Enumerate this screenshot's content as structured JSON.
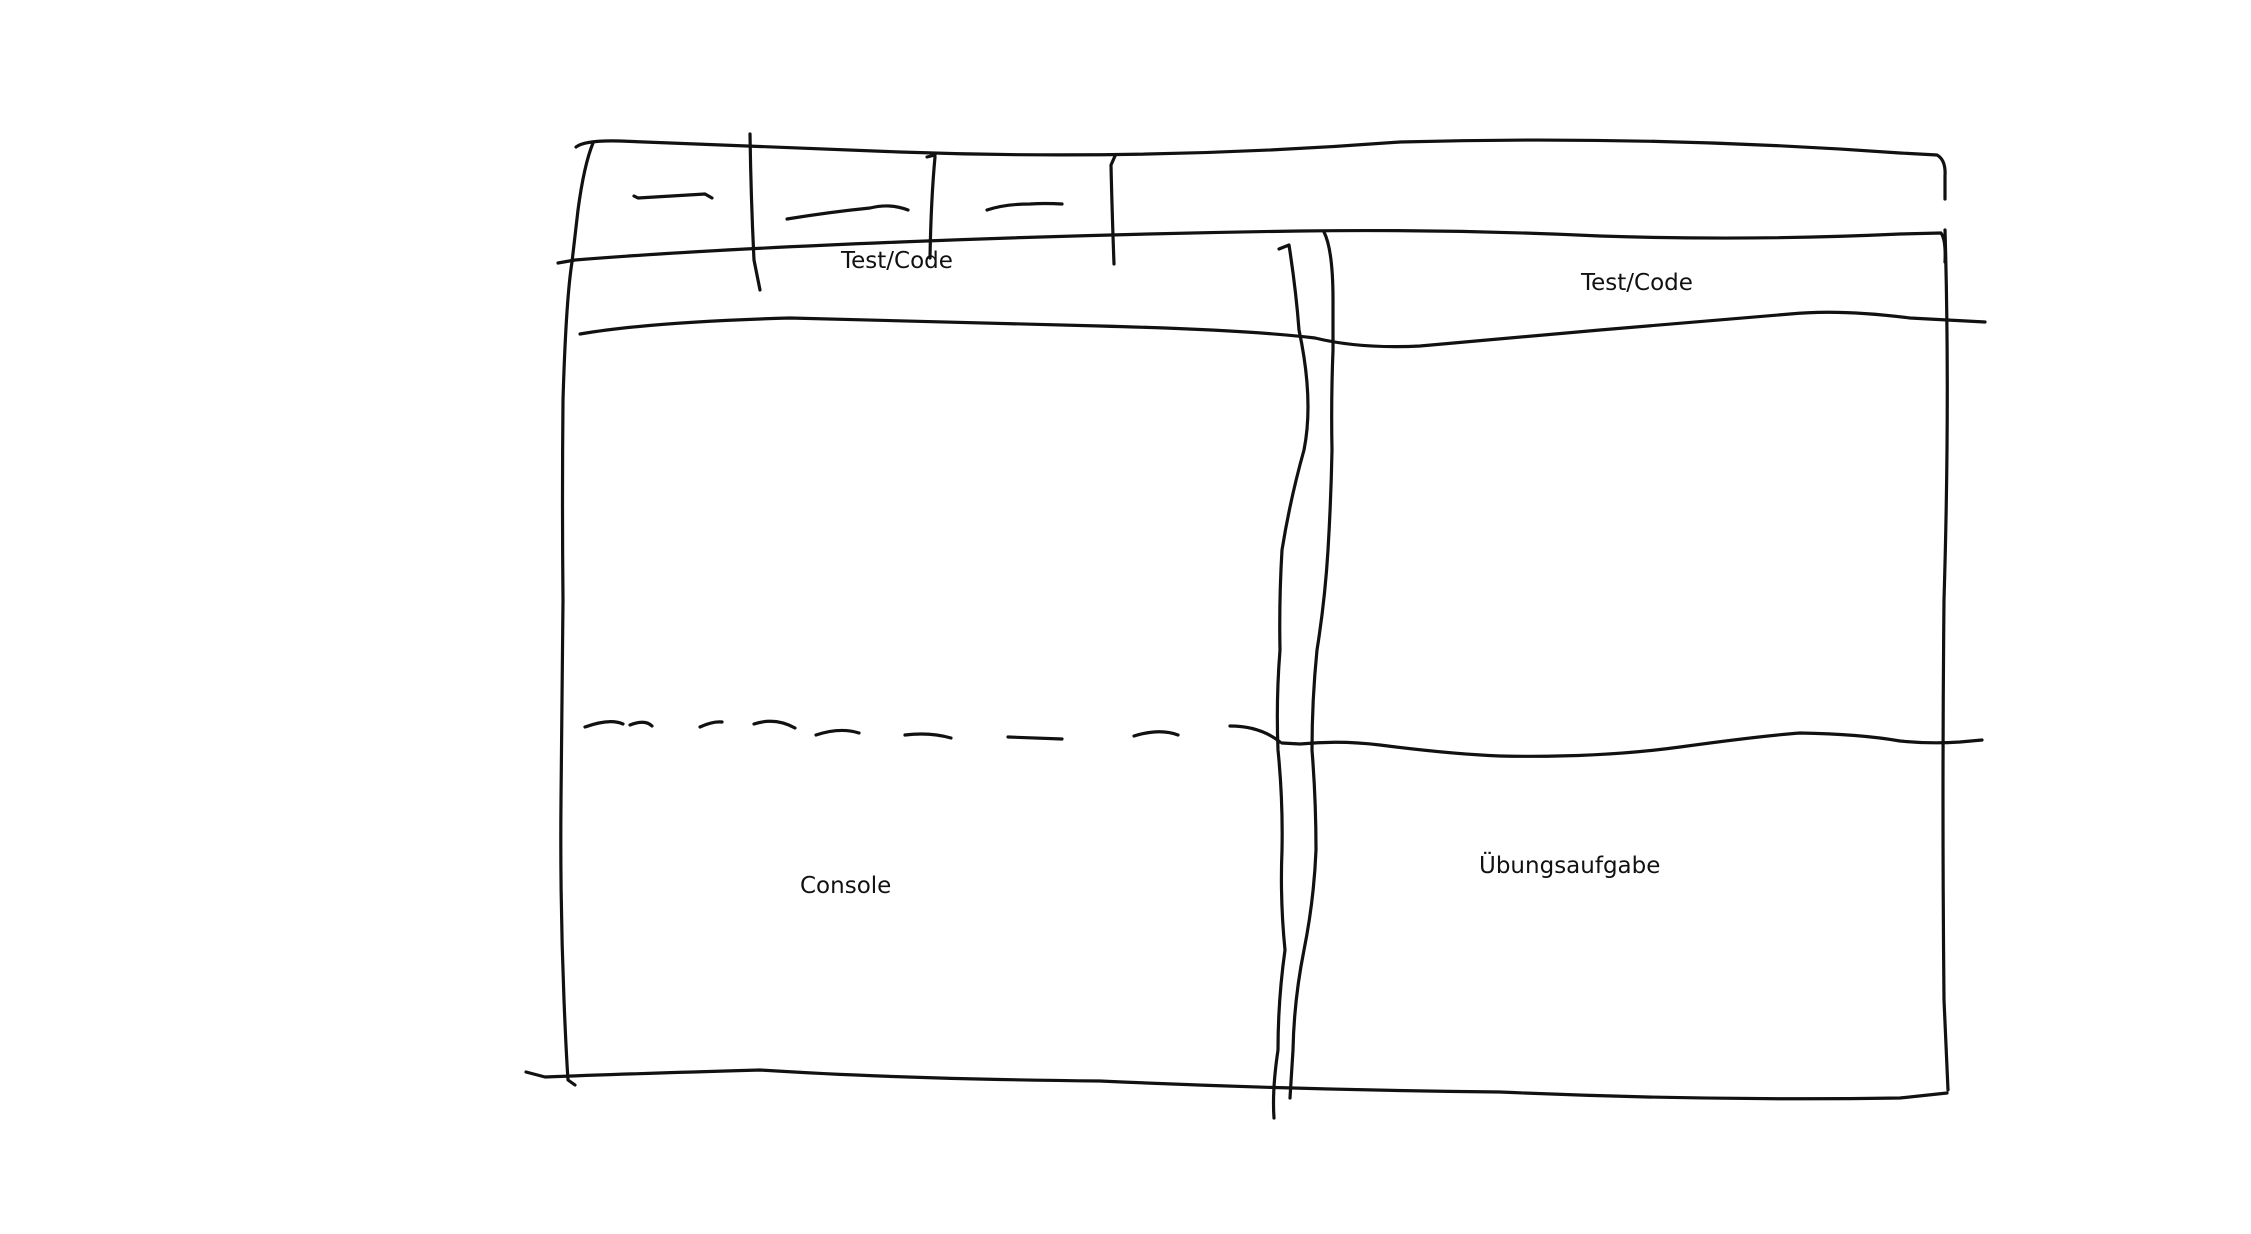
{
  "labels": {
    "left_top": "Test/Code",
    "right_top": "Test/Code",
    "console": "Console",
    "exercise": "Übungsaufgabe"
  }
}
